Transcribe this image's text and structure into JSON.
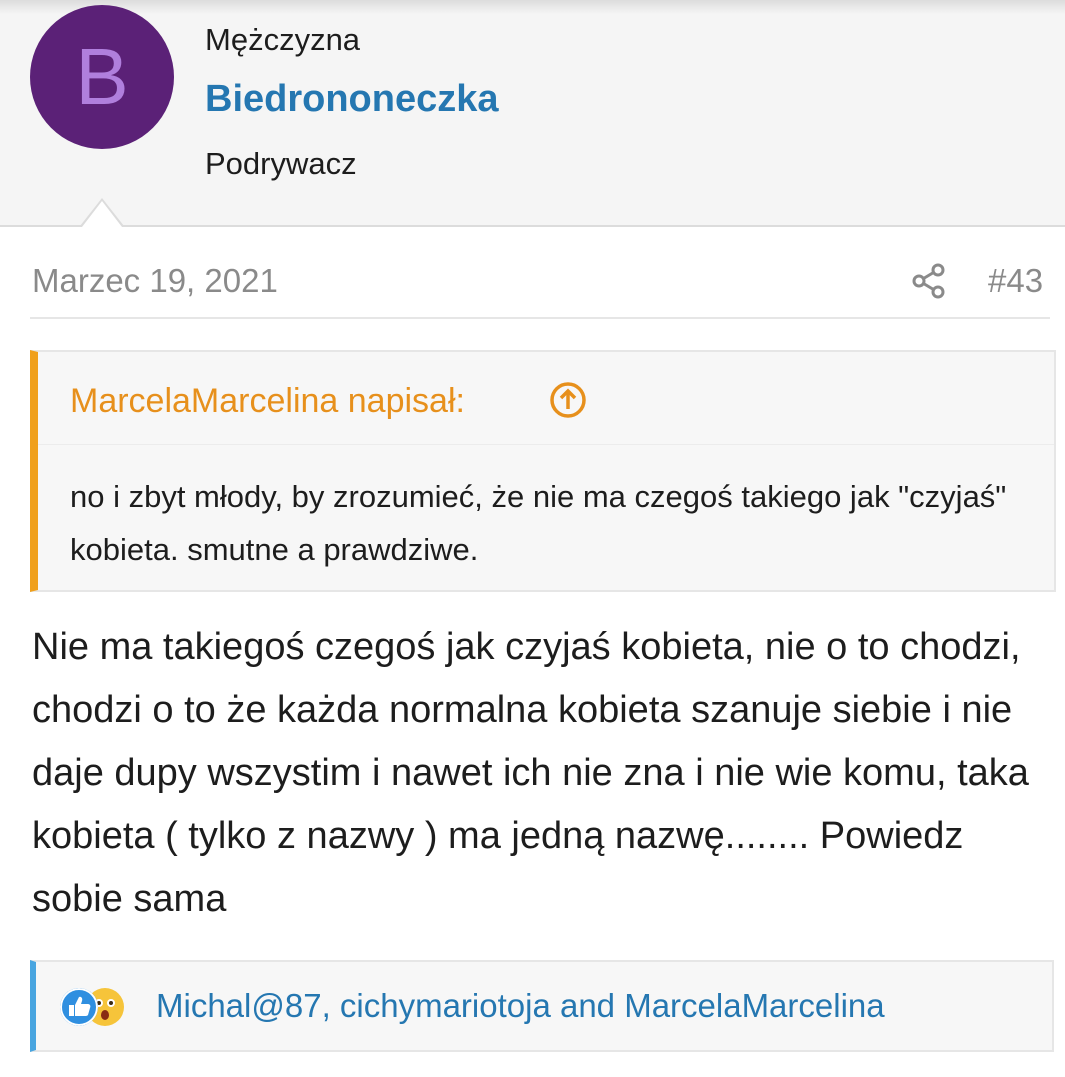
{
  "user": {
    "avatar_letter": "B",
    "gender": "Mężczyzna",
    "username": "Biedrononeczka",
    "title": "Podrywacz",
    "avatar_color": "#5b2177",
    "username_color": "#2577b1"
  },
  "post": {
    "date": "Marzec 19, 2021",
    "share_icon": "share-icon",
    "number": "#43",
    "body": "Nie ma takiegoś czegoś jak czyjaś kobieta, nie o to chodzi, chodzi o to że każda normalna kobieta szanuje siebie i nie daje dupy wszystim i nawet ich nie zna i nie wie komu, taka kobieta ( tylko z nazwy ) ma jedną nazwę........ Powiedz sobie sama"
  },
  "quote": {
    "author": "MarcelaMarcelina napisał:",
    "jump_icon": "arrow-up-circle-icon",
    "text": "no i zbyt młody, by zrozumieć, że nie ma czegoś takiego jak \"czyjaś\" kobieta. smutne a prawdziwe.",
    "accent_color": "#f0a01c"
  },
  "reactions": {
    "icons": [
      "like-icon",
      "wow-icon"
    ],
    "users": "Michal@87, cichymariotoja and MarcelaMarcelina",
    "accent_color": "#49a5e0"
  }
}
